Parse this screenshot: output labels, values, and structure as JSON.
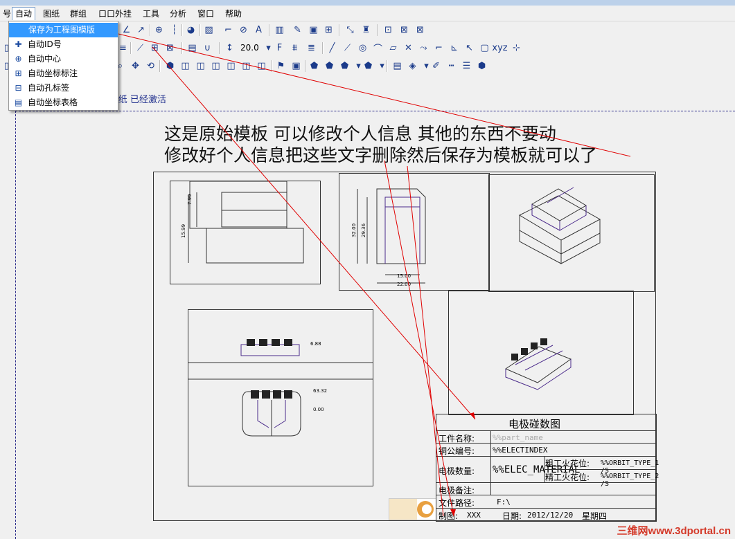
{
  "menubar": {
    "items": [
      {
        "label": "号",
        "active": false
      },
      {
        "label": "自动",
        "active": true
      },
      {
        "label": "图纸",
        "active": false
      },
      {
        "label": "群组",
        "active": false
      },
      {
        "label": "口口外挂",
        "active": false
      },
      {
        "label": "工具",
        "active": false
      },
      {
        "label": "分析",
        "active": false
      },
      {
        "label": "窗口",
        "active": false
      },
      {
        "label": "帮助",
        "active": false
      }
    ]
  },
  "dropdown": {
    "items": [
      {
        "label": "保存为工程图模版",
        "icon": "template-save-icon",
        "highlighted": true
      },
      {
        "label": "自动ID号",
        "icon": "auto-id-icon"
      },
      {
        "label": "自动中心",
        "icon": "auto-center-icon"
      },
      {
        "label": "自动坐标标注",
        "icon": "auto-coordinate-dimension-icon"
      },
      {
        "label": "自动孔标签",
        "icon": "auto-hole-label-icon"
      },
      {
        "label": "自动坐标表格",
        "icon": "auto-coordinate-table-icon"
      }
    ]
  },
  "toolbar": {
    "text_size": "20.0"
  },
  "status": {
    "message": "' 图纸 已经激活"
  },
  "note": {
    "line1": "这是原始模板  可以修改个人信息  其他的东西不要动",
    "line2": "修改好个人信息把这些文字删除然后保存为模板就可以了"
  },
  "drawing": {
    "dims_front": [
      "7.99",
      "15.99"
    ],
    "dims_side": [
      "32.00",
      "29.36",
      "15.00",
      "22.00"
    ],
    "dims_bottom": [
      "6.88",
      "63.32",
      "0.00"
    ]
  },
  "title_block": {
    "title": "电极碰数图",
    "part_name_label": "工件名称:",
    "part_name_value": "%%part_name",
    "copper_no_label": "铜公编号:",
    "copper_no_value": "%%ELECTINDEX",
    "electrode_qty_label": "电极数量:",
    "electrode_qty_value": "%%ELEC_MATERIAL",
    "rough_spark_label": "粗工火花位:",
    "rough_spark_value": "%%ORBIT_TYPE_1 /S",
    "fine_spark_label": "精工火花位:",
    "fine_spark_value": "%%ORBIT_TYPE_2 /S",
    "remark_label": "电极备注:",
    "path_label": "文件路径:",
    "path_value": "F:\\",
    "maker_label": "制图:",
    "maker_value": "XXX",
    "date_label": "日期:",
    "date_value": "2012/12/20",
    "weekday": "星期四"
  },
  "watermark": "三维网www.3dportal.cn",
  "colors": {
    "highlight": "#3399ff",
    "annotation_arrow": "#e00000",
    "model_edge": "#4a2a8a"
  }
}
